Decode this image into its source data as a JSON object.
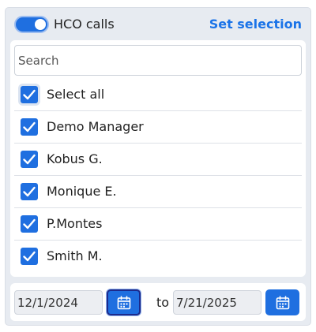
{
  "header": {
    "toggle_label": "HCO calls",
    "toggle_on": true,
    "set_selection_label": "Set selection"
  },
  "search": {
    "placeholder": "Search",
    "value": ""
  },
  "list": {
    "items": [
      {
        "label": "Select all",
        "checked": true
      },
      {
        "label": "Demo Manager",
        "checked": true
      },
      {
        "label": "Kobus G.",
        "checked": true
      },
      {
        "label": "Monique E.",
        "checked": true
      },
      {
        "label": "P.Montes",
        "checked": true
      },
      {
        "label": "Smith M.",
        "checked": true
      }
    ]
  },
  "date_range": {
    "from": "12/1/2024",
    "to_label": "to",
    "to": "7/21/2025"
  },
  "icons": {
    "check": "check-icon",
    "calendar": "calendar-icon"
  },
  "colors": {
    "accent": "#1f6fe0",
    "link": "#1a73e8",
    "panel": "#e7ebf1"
  }
}
